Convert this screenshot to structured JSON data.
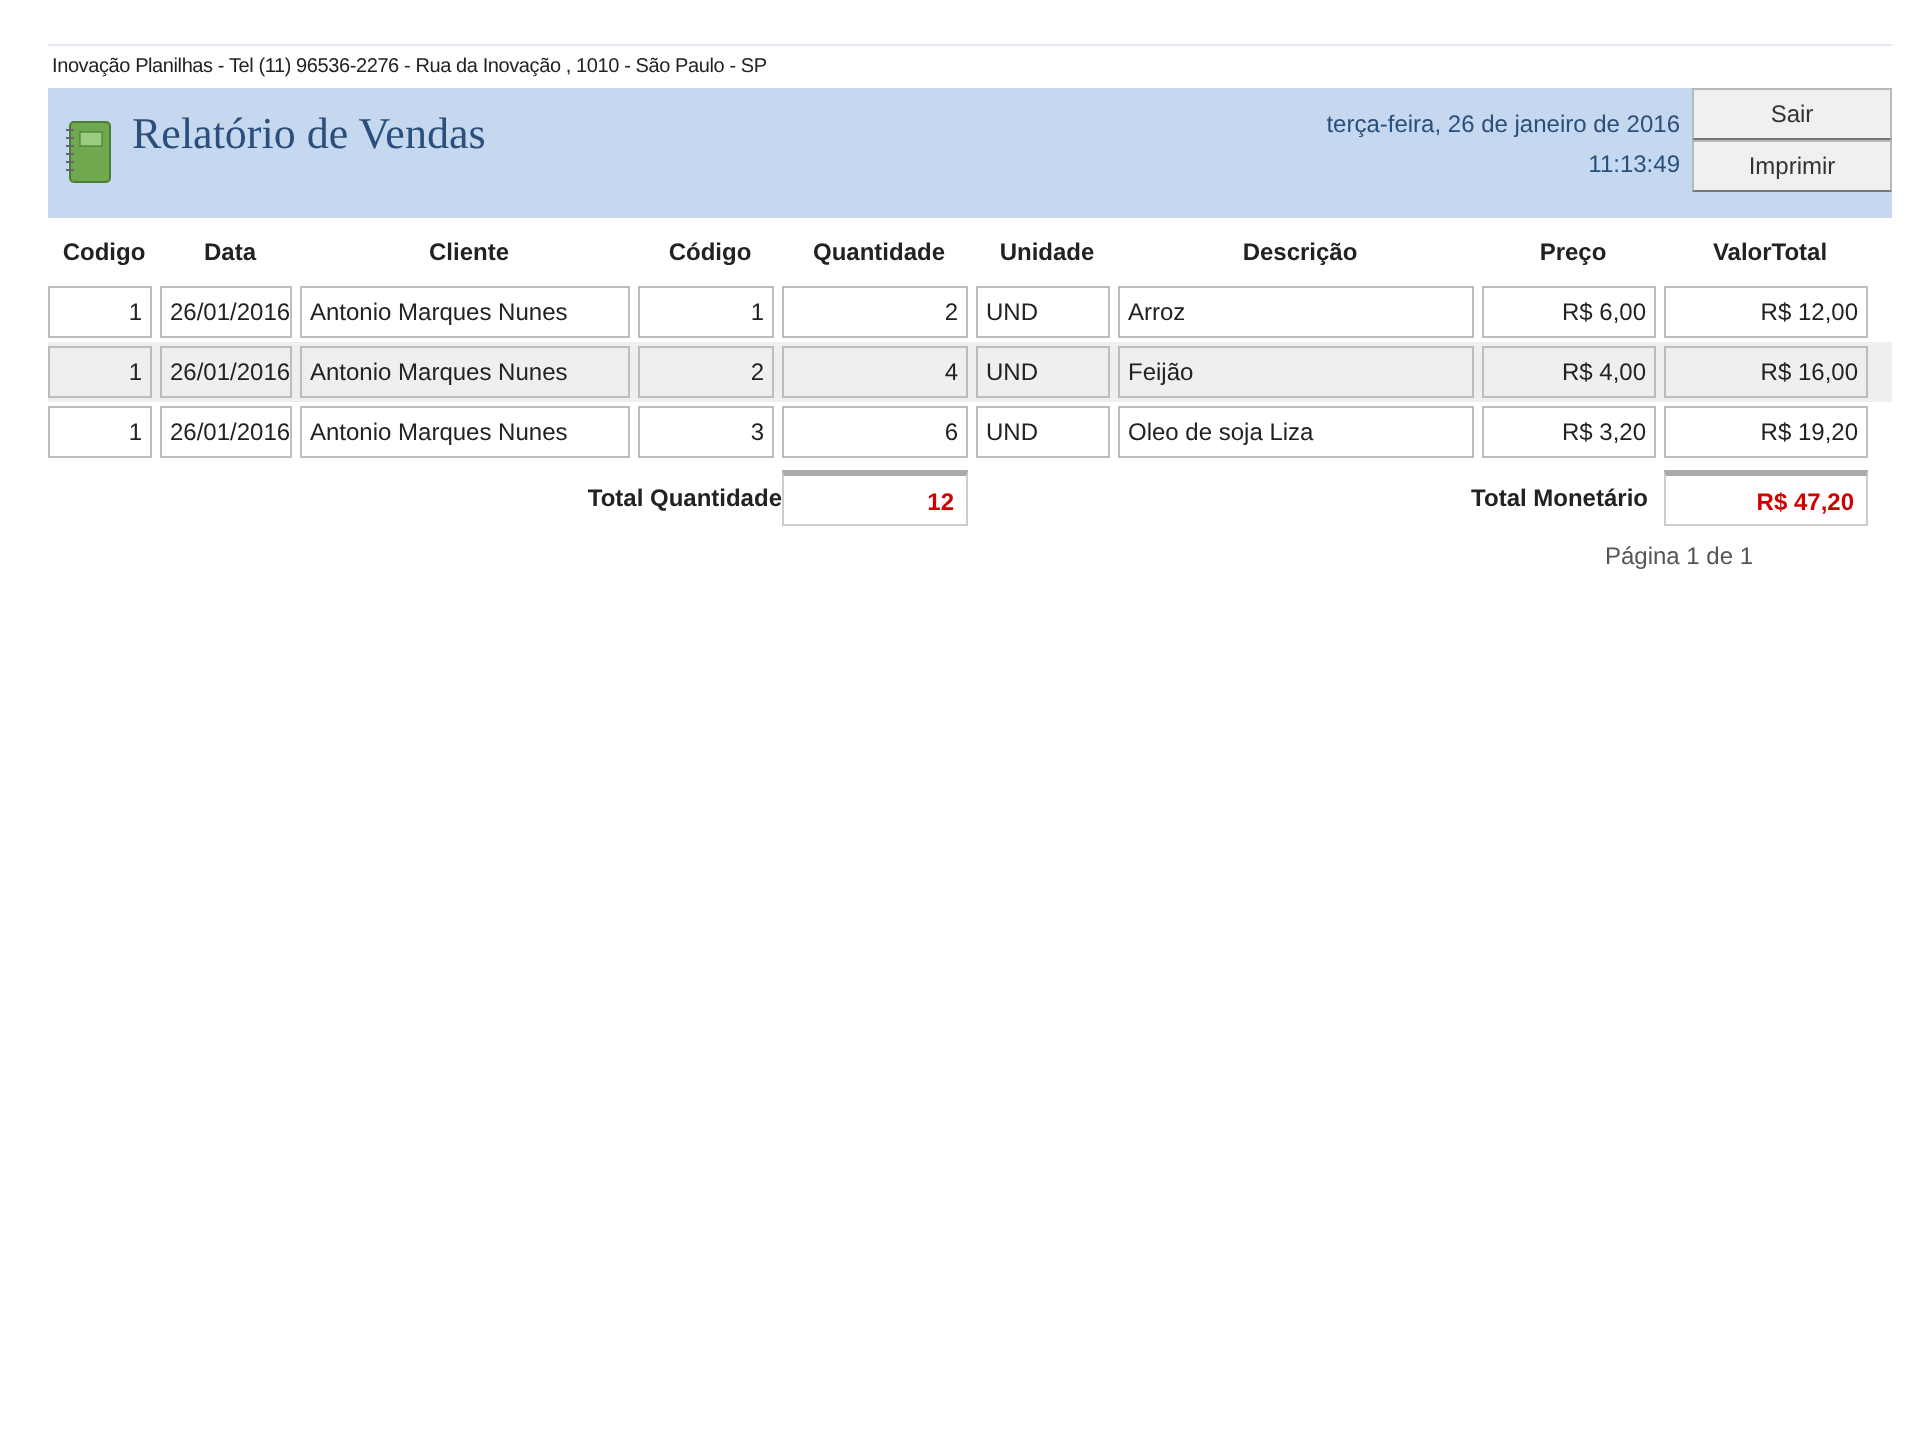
{
  "company_line": "Inovação Planilhas  -  Tel  (11) 96536-2276  -  Rua da Inovação , 1010  -  São Paulo  -  SP",
  "header": {
    "title": "Relatório de Vendas",
    "date": "terça-feira, 26 de janeiro de 2016",
    "time": "11:13:49",
    "buttons": [
      "Sair",
      "Imprimir"
    ]
  },
  "table": {
    "columns": [
      "Codigo",
      "Data",
      "Cliente",
      "Código",
      "Quantidade",
      "Unidade",
      "Descrição",
      "Preço",
      "ValorTotal"
    ],
    "rows": [
      [
        "1",
        "26/01/2016",
        "Antonio Marques Nunes",
        "1",
        "2",
        "UND",
        "Arroz",
        "R$ 6,00",
        "R$ 12,00"
      ],
      [
        "1",
        "26/01/2016",
        "Antonio Marques Nunes",
        "2",
        "4",
        "UND",
        "Feijão",
        "R$ 4,00",
        "R$ 16,00"
      ],
      [
        "1",
        "26/01/2016",
        "Antonio Marques Nunes",
        "3",
        "6",
        "UND",
        "Oleo de soja Liza",
        "R$ 3,20",
        "R$ 19,20"
      ]
    ]
  },
  "totals": {
    "quantity_label": "Total Quantidade",
    "quantity": "12",
    "money_label": "Total Monetário",
    "money": "R$ 47,20"
  },
  "footer": "Página 1 de 1"
}
